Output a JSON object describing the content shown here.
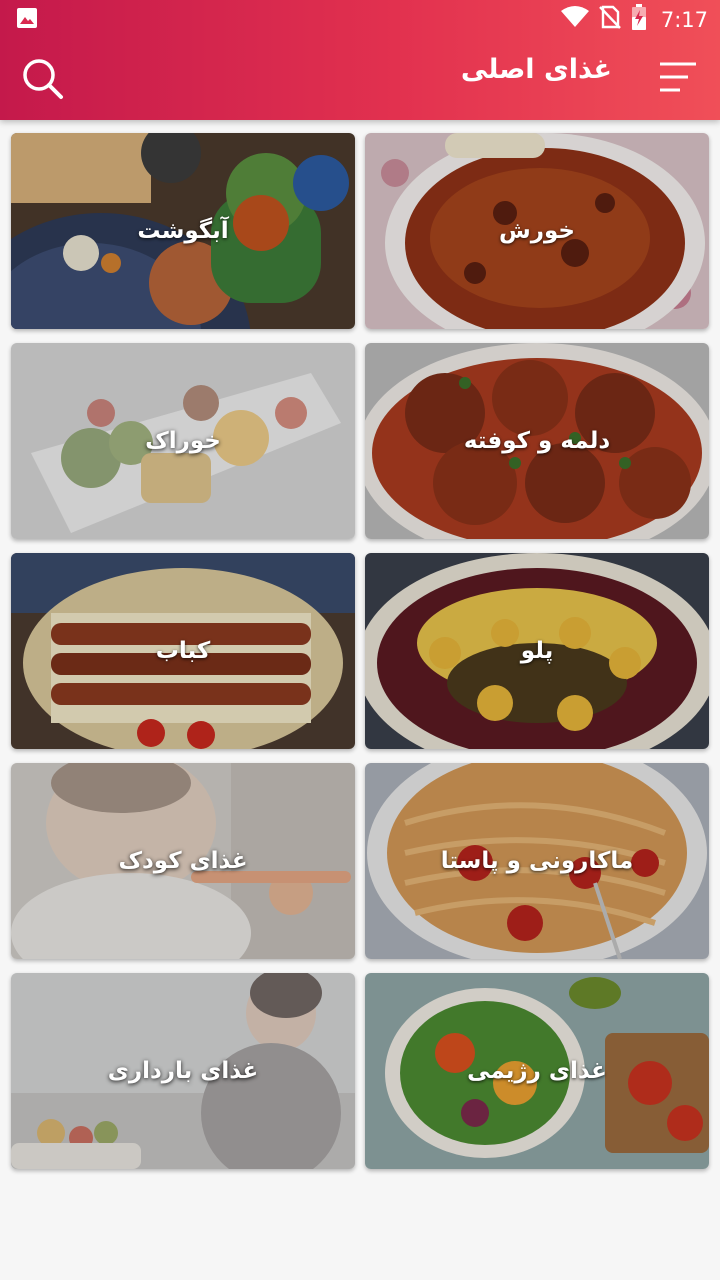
{
  "status_bar": {
    "time": "7:17",
    "icons": [
      "image-icon",
      "wifi-icon",
      "no-sim-icon",
      "battery-charging-icon"
    ]
  },
  "toolbar": {
    "title": "غذای اصلی",
    "menu_icon": "menu-icon",
    "search_icon": "search-icon"
  },
  "categories": [
    {
      "label": "خورش"
    },
    {
      "label": "آبگوشت"
    },
    {
      "label": "دلمه و کوفته"
    },
    {
      "label": "خوراک"
    },
    {
      "label": "پلو"
    },
    {
      "label": "کباب"
    },
    {
      "label": "ماکارونی و پاستا"
    },
    {
      "label": "غذای کودک"
    },
    {
      "label": "غذای رژیمی"
    },
    {
      "label": "غذای بارداری"
    }
  ],
  "colors": {
    "appbar_start": "#c4194b",
    "appbar_end": "#f04f58",
    "background": "#f6f6f6"
  }
}
